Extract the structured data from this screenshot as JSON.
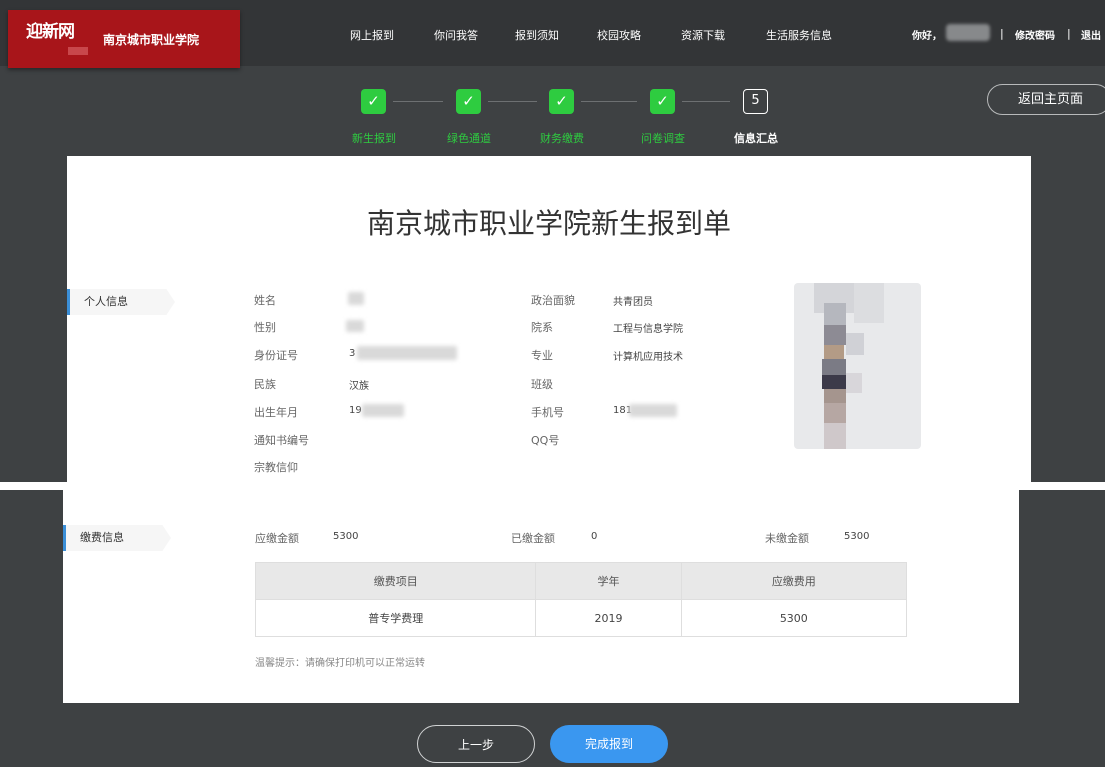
{
  "header": {
    "logo_text": "迎新网",
    "college_name": "南京城市职业学院",
    "nav": [
      "网上报到",
      "你问我答",
      "报到须知",
      "校园攻略",
      "资源下载",
      "生活服务信息"
    ],
    "greeting": "你好，",
    "change_password": "修改密码",
    "logout": "退出",
    "separator": "|"
  },
  "steps": [
    {
      "label": "新生报到",
      "done": true
    },
    {
      "label": "绿色通道",
      "done": true
    },
    {
      "label": "财务缴费",
      "done": true
    },
    {
      "label": "问卷调查",
      "done": true
    },
    {
      "label": "信息汇总",
      "done": false,
      "number": "5"
    }
  ],
  "check_mark": "✓",
  "back_home": "返回主页面",
  "form": {
    "title": "南京城市职业学院新生报到单",
    "personal_section": "个人信息",
    "left_fields": [
      {
        "label": "姓名",
        "value": ""
      },
      {
        "label": "性别",
        "value": ""
      },
      {
        "label": "身份证号",
        "value": "3"
      },
      {
        "label": "民族",
        "value": "汉族"
      },
      {
        "label": "出生年月",
        "value": "19"
      },
      {
        "label": "通知书编号",
        "value": ""
      },
      {
        "label": "宗教信仰",
        "value": ""
      }
    ],
    "right_fields": [
      {
        "label": "政治面貌",
        "value": "共青团员"
      },
      {
        "label": "院系",
        "value": "工程与信息学院"
      },
      {
        "label": "专业",
        "value": "计算机应用技术"
      },
      {
        "label": "班级",
        "value": ""
      },
      {
        "label": "手机号",
        "value": "181"
      },
      {
        "label": "QQ号",
        "value": ""
      }
    ]
  },
  "fees": {
    "section": "缴费信息",
    "due_label": "应缴金额",
    "due_value": "5300",
    "paid_label": "已缴金额",
    "paid_value": "0",
    "unpaid_label": "未缴金额",
    "unpaid_value": "5300",
    "table_headers": [
      "缴费项目",
      "学年",
      "应缴费用"
    ],
    "table_rows": [
      [
        "普专学费理",
        "2019",
        "5300"
      ]
    ],
    "tip": "温馨提示：请确保打印机可以正常运转"
  },
  "buttons": {
    "prev": "上一步",
    "finish": "完成报到"
  },
  "colors": {
    "brand_red": "#a8151a",
    "step_green": "#2ecc40",
    "primary_blue": "#3a97f0",
    "background_dark": "#3e4143"
  }
}
